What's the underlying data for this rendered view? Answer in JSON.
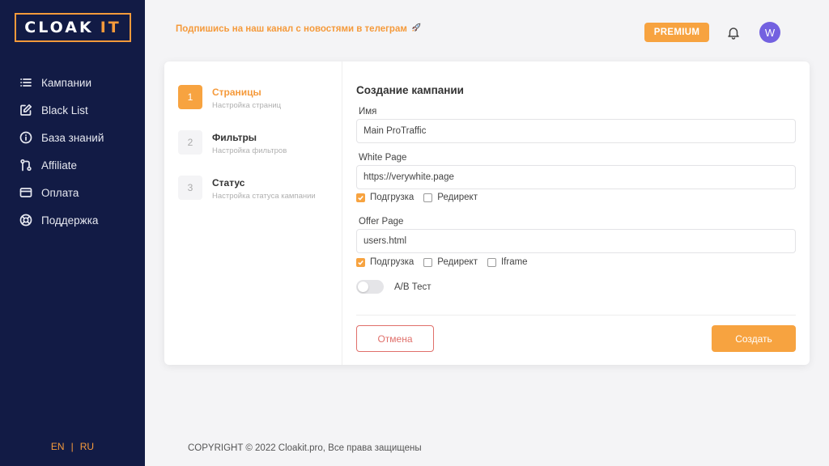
{
  "brand": {
    "logo_main": "CLOAK",
    "logo_accent": "IT",
    "accent_color": "#f7a340",
    "sidebar_color": "#121b45"
  },
  "sidebar": {
    "items": [
      {
        "label": "Кампании",
        "icon": "list-icon"
      },
      {
        "label": "Black List",
        "icon": "edit-icon"
      },
      {
        "label": "База знаний",
        "icon": "info-icon"
      },
      {
        "label": "Affiliate",
        "icon": "git-pull-request-icon"
      },
      {
        "label": "Оплата",
        "icon": "credit-card-icon"
      },
      {
        "label": "Поддержка",
        "icon": "life-buoy-icon"
      }
    ],
    "lang": {
      "en": "EN",
      "sep": "|",
      "ru": "RU"
    }
  },
  "header": {
    "promo": "Подпишись на наш канал с новостями в телеграм",
    "promo_icon": "rocket-icon",
    "premium": "PREMIUM",
    "avatar": "W"
  },
  "steps": [
    {
      "num": "1",
      "title": "Страницы",
      "subtitle": "Настройка страниц",
      "active": true
    },
    {
      "num": "2",
      "title": "Фильтры",
      "subtitle": "Настройка фильтров",
      "active": false
    },
    {
      "num": "3",
      "title": "Статус",
      "subtitle": "Настройка статуса кампании",
      "active": false
    }
  ],
  "form": {
    "title": "Создание кампании",
    "name": {
      "label": "Имя",
      "value": "Main ProTraffic"
    },
    "white_page": {
      "label": "White Page",
      "value": "https://verywhite.page",
      "options": [
        {
          "label": "Подгрузка",
          "checked": true
        },
        {
          "label": "Редирект",
          "checked": false
        }
      ]
    },
    "offer_page": {
      "label": "Offer Page",
      "value": "users.html",
      "options": [
        {
          "label": "Подгрузка",
          "checked": true
        },
        {
          "label": "Редирект",
          "checked": false
        },
        {
          "label": "Iframe",
          "checked": false
        }
      ]
    },
    "ab_test": {
      "label": "A/B Тест",
      "enabled": false
    },
    "cancel": "Отмена",
    "create": "Создать"
  },
  "footer": {
    "copyright": "COPYRIGHT © 2022 Cloakit.pro, Все права защищены"
  }
}
